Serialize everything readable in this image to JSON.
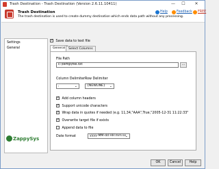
{
  "window": {
    "title": "Trash Destination - Trash Destination (Version 2.6.11.10411)",
    "min": "—",
    "max": "☐",
    "close": "✕"
  },
  "header": {
    "title": "Trash Destination",
    "description": "The trash destination is used to create dummy destination which ends data path without any processing.",
    "links": {
      "help": "Help",
      "feedback": "Feedback",
      "free": "FREE"
    },
    "colors": {
      "help_icon": "#1b76d2",
      "feedback_icon": "#ff8c00",
      "free_icon": "#ff8c00"
    }
  },
  "nav": {
    "items": [
      {
        "label": "Settings"
      },
      {
        "label": "General"
      }
    ]
  },
  "settings": {
    "save_to_file": "Save data to text file",
    "save_to_file_checked": true
  },
  "tabs": [
    {
      "label": "General",
      "active": true
    },
    {
      "label": "Select Columns",
      "active": false
    }
  ],
  "general": {
    "file_path_label": "File Path",
    "file_path_value": "c:\\temp\\file.txt",
    "browse_label": "...",
    "column_delimiter_label": "Column Delimiter",
    "column_delimiter_value": ",",
    "row_delimiter_label": "Row Delimiter",
    "row_delimiter_value": "{NEWLINE}",
    "options": [
      {
        "label": "Add column headers",
        "checked": true
      },
      {
        "label": "Support unicode characters",
        "checked": true
      },
      {
        "label": "Wrap data in quotes if needed (e.g. 11,34,\"AAA\",True,\"2005-12-31 11:22:33\"",
        "checked": true
      },
      {
        "label": "Overwrite target file if exists",
        "checked": true
      },
      {
        "label": "Append data to file",
        "checked": false
      }
    ],
    "date_format_label": "Date format",
    "date_format_value": "yyyy-MM-dd HH:mm:ss"
  },
  "logo": {
    "text": "ZappySys",
    "color": "#2e7d32"
  },
  "footer": {
    "ok": "OK",
    "cancel": "Cancel",
    "help": "Help"
  }
}
